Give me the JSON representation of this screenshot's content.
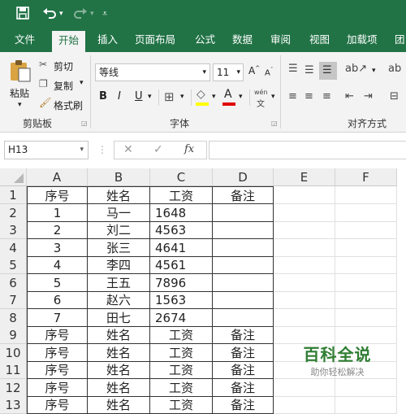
{
  "ribbon_tabs": [
    "文件",
    "开始",
    "插入",
    "页面布局",
    "公式",
    "数据",
    "审阅",
    "视图",
    "加载项",
    "团"
  ],
  "clipboard": {
    "paste": "粘贴",
    "cut": "剪切",
    "copy": "复制",
    "format_painter": "格式刷",
    "group": "剪贴板"
  },
  "font": {
    "name": "等线",
    "size": "11",
    "group": "字体",
    "bold": "B",
    "italic": "I",
    "underline": "U",
    "color_letter": "A",
    "phonetic": "wén"
  },
  "alignment": {
    "group": "对齐方式"
  },
  "name_box": "H13",
  "formula": {
    "cancel": "✕",
    "enter": "✓",
    "fx": "fx",
    "value": ""
  },
  "columns": [
    "A",
    "B",
    "C",
    "D",
    "E",
    "F"
  ],
  "rows": [
    {
      "num": "1",
      "a": "序号",
      "b": "姓名",
      "c": "工资",
      "d": "备注"
    },
    {
      "num": "2",
      "a": "1",
      "b": "马一",
      "c": "1648",
      "d": ""
    },
    {
      "num": "3",
      "a": "2",
      "b": "刘二",
      "c": "4563",
      "d": ""
    },
    {
      "num": "4",
      "a": "3",
      "b": "张三",
      "c": "4641",
      "d": ""
    },
    {
      "num": "5",
      "a": "4",
      "b": "李四",
      "c": "4561",
      "d": ""
    },
    {
      "num": "6",
      "a": "5",
      "b": "王五",
      "c": "7896",
      "d": ""
    },
    {
      "num": "7",
      "a": "6",
      "b": "赵六",
      "c": "1563",
      "d": ""
    },
    {
      "num": "8",
      "a": "7",
      "b": "田七",
      "c": "2674",
      "d": ""
    },
    {
      "num": "9",
      "a": "序号",
      "b": "姓名",
      "c": "工资",
      "d": "备注"
    },
    {
      "num": "10",
      "a": "序号",
      "b": "姓名",
      "c": "工资",
      "d": "备注"
    },
    {
      "num": "11",
      "a": "序号",
      "b": "姓名",
      "c": "工资",
      "d": "备注"
    },
    {
      "num": "12",
      "a": "序号",
      "b": "姓名",
      "c": "工资",
      "d": "备注"
    },
    {
      "num": "13",
      "a": "序号",
      "b": "姓名",
      "c": "工资",
      "d": "备注"
    }
  ],
  "watermark": {
    "title": "百科全说",
    "subtitle": "助你轻松解决"
  },
  "colors": {
    "accent": "#217346",
    "ribbon_bg": "#f3f3f3",
    "header_bg": "#efefef"
  }
}
